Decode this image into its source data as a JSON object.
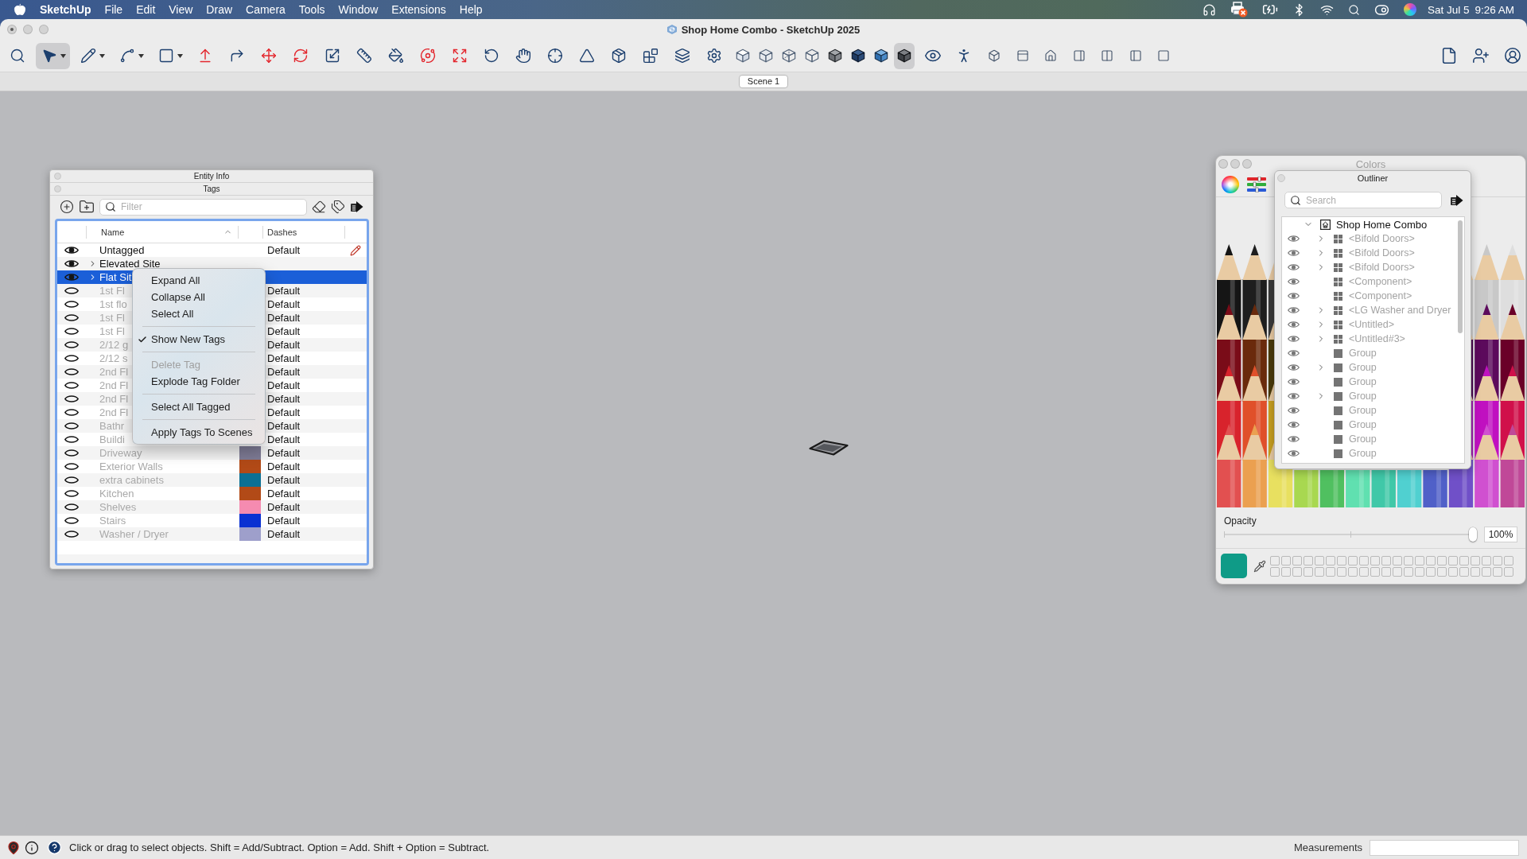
{
  "menu_bar": {
    "app_name": "SketchUp",
    "menus": [
      "File",
      "Edit",
      "View",
      "Draw",
      "Camera",
      "Tools",
      "Window",
      "Extensions",
      "Help"
    ],
    "date": "Sat Jul 5",
    "time": "9:26 AM"
  },
  "window": {
    "title": "Shop Home Combo - SketchUp 2025",
    "active": false,
    "edited": true
  },
  "toolbar": {
    "groups": [
      {
        "kind": "tools",
        "items": [
          {
            "kind": "search",
            "selected": false
          },
          {
            "kind": "select",
            "selected": true
          },
          {
            "kind": "line",
            "selected": false
          },
          {
            "kind": "arc",
            "selected": false
          },
          {
            "kind": "rectangle",
            "selected": false
          },
          {
            "kind": "pushpull",
            "selected": false
          },
          {
            "kind": "offset",
            "selected": false
          },
          {
            "kind": "move",
            "selected": false
          },
          {
            "kind": "rotate",
            "selected": false
          },
          {
            "kind": "scale",
            "selected": false
          },
          {
            "kind": "tape",
            "selected": false
          },
          {
            "kind": "paint",
            "selected": false
          },
          {
            "kind": "orbit",
            "selected": false
          },
          {
            "kind": "zoomextents",
            "selected": false
          },
          {
            "kind": "followme",
            "selected": false
          },
          {
            "kind": "pan",
            "selected": false
          },
          {
            "kind": "position",
            "selected": false
          },
          {
            "kind": "section",
            "selected": false
          },
          {
            "kind": "warehouse",
            "selected": false
          },
          {
            "kind": "extensions",
            "selected": false
          },
          {
            "kind": "layout",
            "selected": false
          },
          {
            "kind": "manager",
            "selected": false
          }
        ]
      },
      {
        "kind": "styles",
        "items": [
          {
            "kind": "box",
            "selected": false
          },
          {
            "kind": "xray",
            "selected": false
          },
          {
            "kind": "backedges",
            "selected": false
          },
          {
            "kind": "wireframe",
            "selected": false
          },
          {
            "kind": "hiddenline",
            "selected": false
          },
          {
            "kind": "shaded",
            "selected": false
          },
          {
            "kind": "textured",
            "selected": false
          },
          {
            "kind": "monochrome",
            "selected": true
          }
        ]
      },
      {
        "kind": "camera",
        "items": [
          {
            "kind": "look",
            "selected": false
          },
          {
            "kind": "walk",
            "selected": false
          }
        ]
      },
      {
        "kind": "views",
        "items": [
          {
            "kind": "iso",
            "selected": false
          },
          {
            "kind": "top",
            "selected": false
          },
          {
            "kind": "front",
            "selected": false
          },
          {
            "kind": "right",
            "selected": false
          },
          {
            "kind": "back",
            "selected": false
          },
          {
            "kind": "left",
            "selected": false
          },
          {
            "kind": "bottom",
            "selected": false
          }
        ]
      },
      {
        "kind": "account",
        "items": [
          {
            "kind": "document",
            "selected": false
          },
          {
            "kind": "adduser",
            "selected": false
          },
          {
            "kind": "account",
            "selected": false
          }
        ]
      }
    ]
  },
  "scenes": [
    {
      "label": "Scene 1",
      "selected": true
    }
  ],
  "tags_panel": {
    "collapsed_title": "Entity Info",
    "title": "Tags",
    "filter": {
      "placeholder": "Filter"
    },
    "columns": [
      {
        "label": "Name",
        "sorted": true
      },
      {
        "label": "Dashes",
        "sorted": false
      }
    ],
    "rows": [
      {
        "name": "Untagged",
        "visible": true,
        "selected": false,
        "current": true,
        "dashes": "Default"
      },
      {
        "name": "Elevated Site",
        "visible": true,
        "selected": false,
        "current": false,
        "expanded": false
      },
      {
        "name": "Flat Sit",
        "visible": true,
        "selected": true,
        "current": false,
        "expanded": false
      },
      {
        "name": "1st Fl",
        "visible": false,
        "selected": false,
        "current": false,
        "dashes": "Default"
      },
      {
        "name": "1st flo",
        "visible": false,
        "selected": false,
        "current": false,
        "dashes": "Default"
      },
      {
        "name": "1st Fl",
        "visible": false,
        "selected": false,
        "current": false,
        "dashes": "Default"
      },
      {
        "name": "1st Fl",
        "visible": false,
        "selected": false,
        "current": false,
        "dashes": "Default"
      },
      {
        "name": "2/12 g",
        "visible": false,
        "selected": false,
        "current": false,
        "dashes": "Default"
      },
      {
        "name": "2/12 s",
        "visible": false,
        "selected": false,
        "current": false,
        "dashes": "Default"
      },
      {
        "name": "2nd Fl",
        "visible": false,
        "selected": false,
        "current": false,
        "dashes": "Default"
      },
      {
        "name": "2nd Fl",
        "visible": false,
        "selected": false,
        "current": false,
        "dashes": "Default"
      },
      {
        "name": "2nd Fl",
        "visible": false,
        "selected": false,
        "current": false,
        "dashes": "Default"
      },
      {
        "name": "2nd Fl",
        "visible": false,
        "selected": false,
        "current": false,
        "dashes": "Default"
      },
      {
        "name": "Bathr",
        "visible": false,
        "selected": false,
        "current": false,
        "dashes": "Default"
      },
      {
        "name": "Buildi",
        "visible": false,
        "selected": false,
        "current": false,
        "dashes": "Default"
      },
      {
        "name": "Driveway",
        "visible": false,
        "selected": false,
        "current": false,
        "color": "#7e7b95",
        "dashes": "Default"
      },
      {
        "name": "Exterior Walls",
        "visible": false,
        "selected": false,
        "current": false,
        "color": "#b24a17",
        "dashes": "Default"
      },
      {
        "name": "extra cabinets",
        "visible": false,
        "selected": false,
        "current": false,
        "color": "#0c7094",
        "dashes": "Default"
      },
      {
        "name": "Kitchen",
        "visible": false,
        "selected": false,
        "current": false,
        "color": "#b24a17",
        "dashes": "Default"
      },
      {
        "name": "Shelves",
        "visible": false,
        "selected": false,
        "current": false,
        "color": "#f58bb0",
        "dashes": "Default"
      },
      {
        "name": "Stairs",
        "visible": false,
        "selected": false,
        "current": false,
        "color": "#0a31d2",
        "dashes": "Default"
      },
      {
        "name": "Washer / Dryer",
        "visible": false,
        "selected": false,
        "current": false,
        "color": "#9e9fcb",
        "dashes": "Default"
      }
    ],
    "context_menu": {
      "sections": [
        [
          {
            "label": "Expand All",
            "checked": false,
            "disabled": false
          },
          {
            "label": "Collapse All",
            "checked": false,
            "disabled": false
          },
          {
            "label": "Select All",
            "checked": false,
            "disabled": false
          }
        ],
        [
          {
            "label": "Show New Tags",
            "checked": true,
            "disabled": false
          }
        ],
        [
          {
            "label": "Delete Tag",
            "checked": false,
            "disabled": true
          },
          {
            "label": "Explode Tag Folder",
            "checked": false,
            "disabled": false
          }
        ],
        [
          {
            "label": "Select All Tagged",
            "checked": false,
            "disabled": false
          }
        ],
        [
          {
            "label": "Apply Tags To Scenes",
            "checked": false,
            "disabled": false
          }
        ]
      ]
    }
  },
  "colors_panel": {
    "title": "Colors",
    "active": false,
    "opacity": {
      "label": "Opacity",
      "level": 1,
      "value": "100%"
    }
  },
  "outliner": {
    "title": "Outliner",
    "search": {
      "placeholder": "Search"
    },
    "model": {
      "label": "Shop Home Combo",
      "kind": "model",
      "expanded": true,
      "children": [
        {
          "label": "<Bifold Doors>",
          "kind": "component",
          "visible": true,
          "greyed": true,
          "expanded": false
        },
        {
          "label": "<Bifold Doors>",
          "kind": "component",
          "visible": true,
          "greyed": true,
          "expanded": false
        },
        {
          "label": "<Bifold Doors>",
          "kind": "component",
          "visible": true,
          "greyed": true,
          "expanded": false
        },
        {
          "label": "<Component>",
          "kind": "component",
          "visible": true,
          "greyed": true
        },
        {
          "label": "<Component>",
          "kind": "component",
          "visible": true,
          "greyed": true
        },
        {
          "label": "<LG Washer and Dryer",
          "kind": "component",
          "visible": true,
          "greyed": true,
          "expanded": false
        },
        {
          "label": "<Untitled>",
          "kind": "component",
          "visible": true,
          "greyed": true,
          "expanded": false
        },
        {
          "label": "<Untitled#3>",
          "kind": "component",
          "visible": true,
          "greyed": true,
          "expanded": false
        },
        {
          "label": "Group",
          "kind": "group",
          "visible": true,
          "greyed": true
        },
        {
          "label": "Group",
          "kind": "group",
          "visible": true,
          "greyed": true,
          "expanded": false
        },
        {
          "label": "Group",
          "kind": "group",
          "visible": true,
          "greyed": true
        },
        {
          "label": "Group",
          "kind": "group",
          "visible": true,
          "greyed": true,
          "expanded": false
        },
        {
          "label": "Group",
          "kind": "group",
          "visible": true,
          "greyed": true
        },
        {
          "label": "Group",
          "kind": "group",
          "visible": true,
          "greyed": true
        },
        {
          "label": "Group",
          "kind": "group",
          "visible": true,
          "greyed": true
        },
        {
          "label": "Group",
          "kind": "group",
          "visible": true,
          "greyed": true
        }
      ]
    }
  },
  "status_bar": {
    "message": "Click or drag to select objects. Shift = Add/Subtract. Option = Add. Shift + Option = Subtract.",
    "measurements_label": "Measurements"
  }
}
